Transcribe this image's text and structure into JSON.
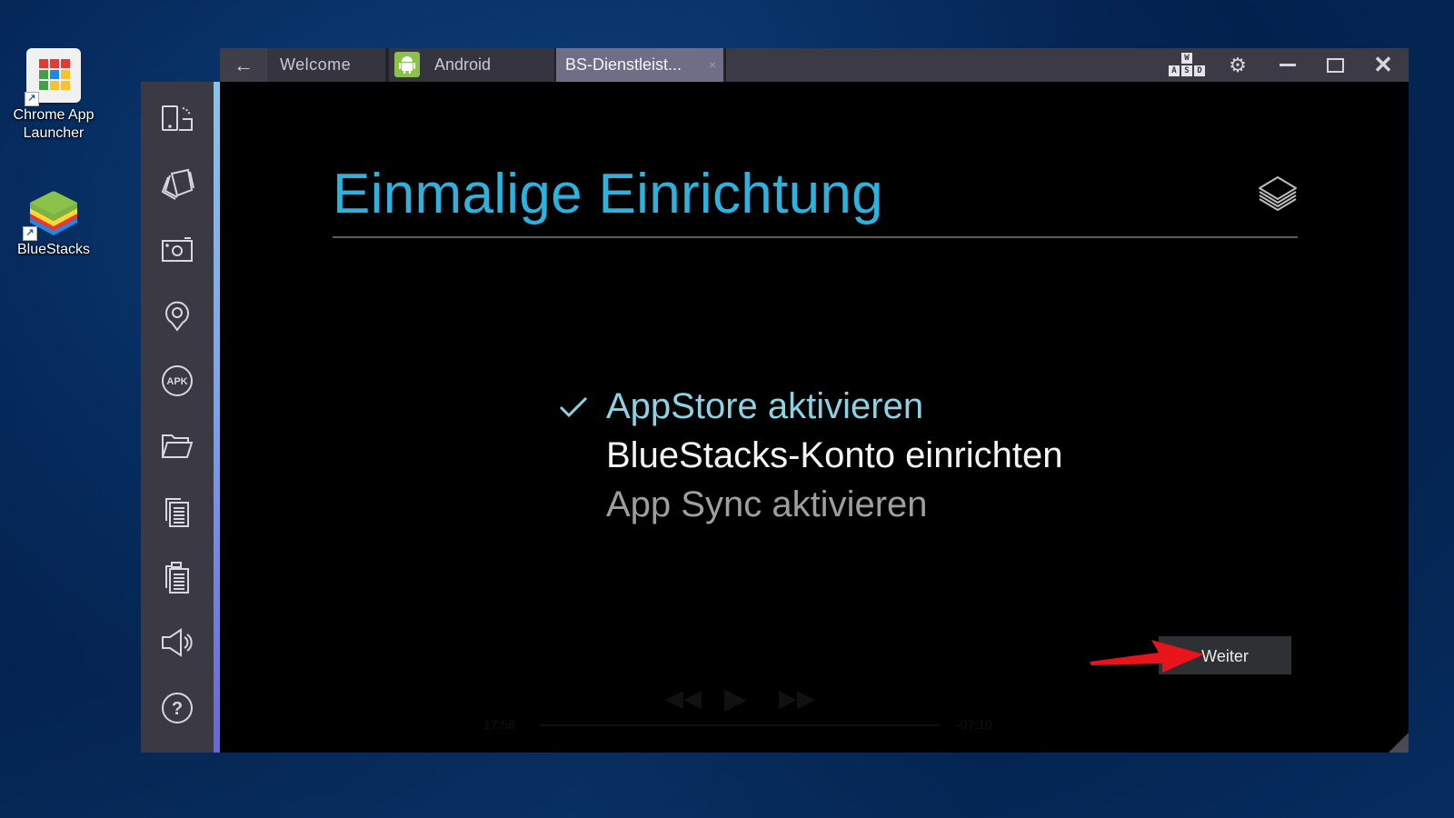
{
  "desktop": {
    "icons": [
      {
        "label_line1": "Chrome App",
        "label_line2": "Launcher",
        "icon": "chrome-app-launcher-icon"
      },
      {
        "label_line1": "BlueStacks",
        "label_line2": "",
        "icon": "bluestacks-icon"
      }
    ],
    "chrome_grid_colors": [
      "#e53935",
      "#e53935",
      "#e53935",
      "#43a047",
      "#1e88e5",
      "#fbc02d",
      "#43a047",
      "#fbc02d",
      "#fbc02d"
    ]
  },
  "window": {
    "back_glyph": "←",
    "tabs": [
      {
        "label": "Welcome"
      },
      {
        "label": "Android",
        "icon": "android-icon"
      },
      {
        "label": "BS-Dienstleist...",
        "active": true,
        "close_glyph": "×"
      }
    ],
    "keymap_keys": {
      "top": "W",
      "bottom": [
        "A",
        "S",
        "D"
      ]
    },
    "settings_glyph": "⚙",
    "close_glyph": "✕"
  },
  "sidebar": {
    "items": [
      {
        "name": "rotate-screen",
        "icon": "rotate-icon"
      },
      {
        "name": "shake",
        "icon": "shake-icon"
      },
      {
        "name": "screenshot",
        "icon": "camera-icon"
      },
      {
        "name": "location",
        "icon": "location-pin-icon"
      },
      {
        "name": "install-apk",
        "icon": "apk-icon",
        "text": "APK"
      },
      {
        "name": "open-folder",
        "icon": "folder-icon"
      },
      {
        "name": "copy",
        "icon": "copy-icon"
      },
      {
        "name": "paste",
        "icon": "paste-icon"
      },
      {
        "name": "volume",
        "icon": "speaker-icon"
      },
      {
        "name": "help",
        "icon": "help-icon",
        "text": "?"
      }
    ]
  },
  "setup": {
    "title": "Einmalige Einrichtung",
    "check_glyph": "✓",
    "steps": [
      {
        "label": "AppStore aktivieren",
        "status": "done"
      },
      {
        "label": "BlueStacks-Konto einrichten",
        "status": "current"
      },
      {
        "label": "App Sync aktivieren",
        "status": "pending"
      }
    ],
    "next_label": "Weiter",
    "colors": {
      "title": "#2cb2dd",
      "done": "#8dd2e4",
      "current": "#f4f4f4",
      "pending": "#9e9e9e",
      "annotation_arrow": "#e8141c"
    }
  },
  "video_overlay": {
    "elapsed": "17:56",
    "remaining": "-07:10",
    "progress": 0.72
  }
}
